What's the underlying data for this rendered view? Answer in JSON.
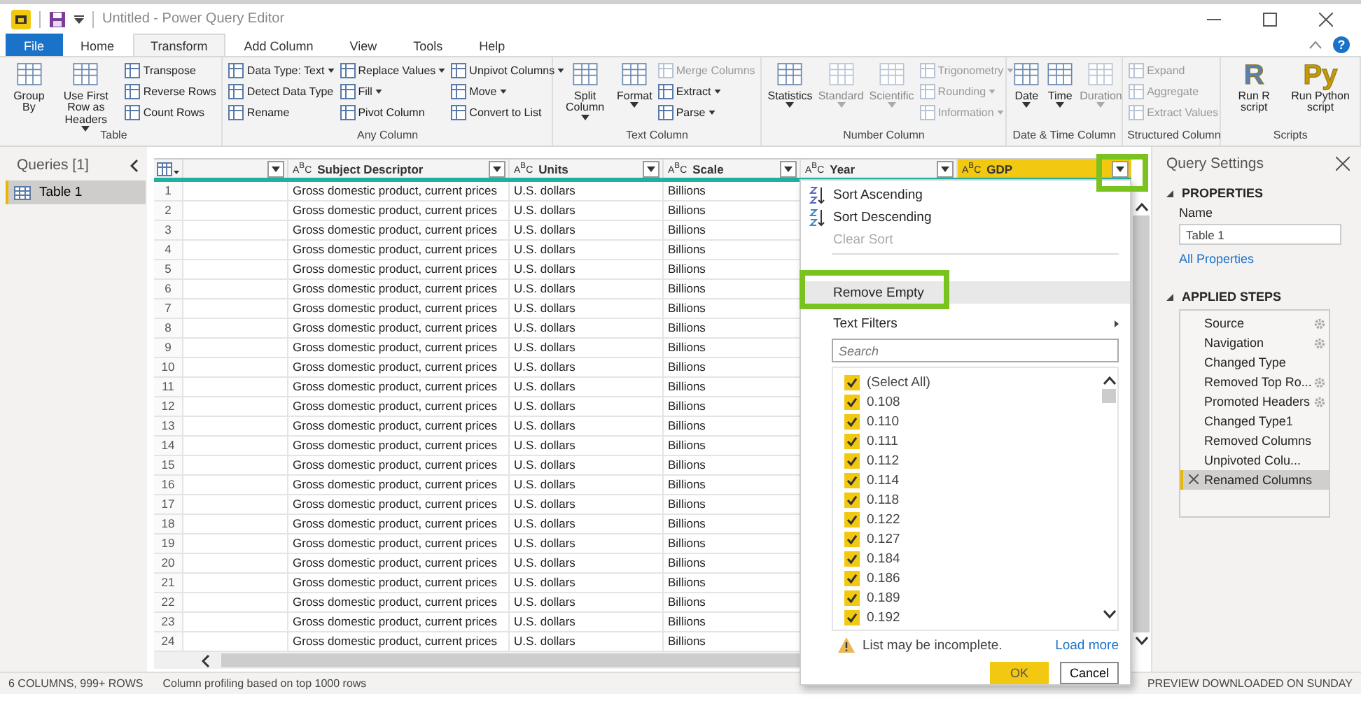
{
  "window": {
    "title": "Untitled - Power Query Editor"
  },
  "ribbon": {
    "help": "?",
    "tabs": [
      {
        "label": "File",
        "kind": "file",
        "selected": false
      },
      {
        "label": "Home",
        "kind": "tab",
        "selected": false
      },
      {
        "label": "Transform",
        "kind": "tab",
        "selected": true
      },
      {
        "label": "Add Column",
        "kind": "tab",
        "selected": false
      },
      {
        "label": "View",
        "kind": "tab",
        "selected": false
      },
      {
        "label": "Tools",
        "kind": "tab",
        "selected": false
      },
      {
        "label": "Help",
        "kind": "tab",
        "selected": false
      }
    ],
    "groups": [
      {
        "label": "Table",
        "items": [
          {
            "kind": "large",
            "label": "Group By",
            "dropdown": false,
            "disabled": false
          },
          {
            "kind": "large",
            "label": "Use First Row as Headers",
            "dropdown": true,
            "disabled": false
          },
          {
            "kind": "stack",
            "items": [
              {
                "label": "Transpose",
                "dropdown": false,
                "disabled": false
              },
              {
                "label": "Reverse Rows",
                "dropdown": false,
                "disabled": false
              },
              {
                "label": "Count Rows",
                "dropdown": false,
                "disabled": false
              }
            ]
          }
        ]
      },
      {
        "label": "Any Column",
        "items": [
          {
            "kind": "stack",
            "items": [
              {
                "label": "Data Type: Text",
                "dropdown": true,
                "disabled": false
              },
              {
                "label": "Detect Data Type",
                "dropdown": false,
                "disabled": false
              },
              {
                "label": "Rename",
                "dropdown": false,
                "disabled": false
              }
            ]
          },
          {
            "kind": "stack",
            "items": [
              {
                "label": "Replace Values",
                "dropdown": true,
                "disabled": false
              },
              {
                "label": "Fill",
                "dropdown": true,
                "disabled": false
              },
              {
                "label": "Pivot Column",
                "dropdown": false,
                "disabled": false
              }
            ]
          },
          {
            "kind": "stack",
            "items": [
              {
                "label": "Unpivot Columns",
                "dropdown": true,
                "disabled": false
              },
              {
                "label": "Move",
                "dropdown": true,
                "disabled": false
              },
              {
                "label": "Convert to List",
                "dropdown": false,
                "disabled": false
              }
            ]
          }
        ]
      },
      {
        "label": "Text Column",
        "items": [
          {
            "kind": "large",
            "label": "Split Column",
            "dropdown": true,
            "disabled": false
          },
          {
            "kind": "large",
            "label": "Format",
            "dropdown": true,
            "disabled": false
          },
          {
            "kind": "stack",
            "items": [
              {
                "label": "Merge Columns",
                "dropdown": false,
                "disabled": true
              },
              {
                "label": "Extract",
                "dropdown": true,
                "disabled": false
              },
              {
                "label": "Parse",
                "dropdown": true,
                "disabled": false
              }
            ]
          }
        ]
      },
      {
        "label": "Number Column",
        "items": [
          {
            "kind": "large",
            "label": "Statistics",
            "dropdown": true,
            "disabled": false
          },
          {
            "kind": "large",
            "label": "Standard",
            "dropdown": true,
            "disabled": true
          },
          {
            "kind": "large",
            "label": "Scientific",
            "dropdown": true,
            "disabled": true
          },
          {
            "kind": "stack",
            "items": [
              {
                "label": "Trigonometry",
                "dropdown": true,
                "disabled": true
              },
              {
                "label": "Rounding",
                "dropdown": true,
                "disabled": true
              },
              {
                "label": "Information",
                "dropdown": true,
                "disabled": true
              }
            ]
          }
        ]
      },
      {
        "label": "Date & Time Column",
        "items": [
          {
            "kind": "large",
            "label": "Date",
            "dropdown": true,
            "disabled": false
          },
          {
            "kind": "large",
            "label": "Time",
            "dropdown": true,
            "disabled": false
          },
          {
            "kind": "large",
            "label": "Duration",
            "dropdown": true,
            "disabled": true
          }
        ]
      },
      {
        "label": "Structured Column",
        "items": [
          {
            "kind": "stack",
            "items": [
              {
                "label": "Expand",
                "dropdown": false,
                "disabled": true
              },
              {
                "label": "Aggregate",
                "dropdown": false,
                "disabled": true
              },
              {
                "label": "Extract Values",
                "dropdown": false,
                "disabled": true
              }
            ]
          }
        ]
      },
      {
        "label": "Scripts",
        "items": [
          {
            "kind": "large",
            "glyph": "R",
            "color": "#5b7fae",
            "label": "Run R script",
            "dropdown": false,
            "disabled": false
          },
          {
            "kind": "large",
            "glyph": "Py",
            "color": "#c99a00",
            "label": "Run Python script",
            "dropdown": false,
            "disabled": false
          }
        ]
      }
    ]
  },
  "queries": {
    "title": "Queries [1]",
    "items": [
      {
        "label": "Table 1",
        "selected": true
      }
    ]
  },
  "table": {
    "columns": [
      {
        "kind": "any",
        "selected": false
      },
      {
        "kind": "text",
        "type": "A$^{B}$C",
        "label": "Subject Descriptor",
        "selected": false
      },
      {
        "kind": "text",
        "type": "A$^{B}$C",
        "label": "Units",
        "selected": false
      },
      {
        "kind": "text",
        "type": "A$^{B}$C",
        "label": "Scale",
        "selected": false
      },
      {
        "kind": "text",
        "type": "A$^{B}$C",
        "label": "Year",
        "selected": false
      },
      {
        "kind": "text",
        "type": "A$^{B}$C",
        "label": "GDP",
        "selected": true
      }
    ],
    "rows": [
      {
        "number": "1",
        "subject_descriptor": "Gross domestic product, current prices",
        "units": "U.S. dollars",
        "scale": "Billions"
      },
      {
        "number": "2",
        "subject_descriptor": "Gross domestic product, current prices",
        "units": "U.S. dollars",
        "scale": "Billions"
      },
      {
        "number": "3",
        "subject_descriptor": "Gross domestic product, current prices",
        "units": "U.S. dollars",
        "scale": "Billions"
      },
      {
        "number": "4",
        "subject_descriptor": "Gross domestic product, current prices",
        "units": "U.S. dollars",
        "scale": "Billions"
      },
      {
        "number": "5",
        "subject_descriptor": "Gross domestic product, current prices",
        "units": "U.S. dollars",
        "scale": "Billions"
      },
      {
        "number": "6",
        "subject_descriptor": "Gross domestic product, current prices",
        "units": "U.S. dollars",
        "scale": "Billions"
      },
      {
        "number": "7",
        "subject_descriptor": "Gross domestic product, current prices",
        "units": "U.S. dollars",
        "scale": "Billions"
      },
      {
        "number": "8",
        "subject_descriptor": "Gross domestic product, current prices",
        "units": "U.S. dollars",
        "scale": "Billions"
      },
      {
        "number": "9",
        "subject_descriptor": "Gross domestic product, current prices",
        "units": "U.S. dollars",
        "scale": "Billions"
      },
      {
        "number": "10",
        "subject_descriptor": "Gross domestic product, current prices",
        "units": "U.S. dollars",
        "scale": "Billions"
      },
      {
        "number": "11",
        "subject_descriptor": "Gross domestic product, current prices",
        "units": "U.S. dollars",
        "scale": "Billions"
      },
      {
        "number": "12",
        "subject_descriptor": "Gross domestic product, current prices",
        "units": "U.S. dollars",
        "scale": "Billions"
      },
      {
        "number": "13",
        "subject_descriptor": "Gross domestic product, current prices",
        "units": "U.S. dollars",
        "scale": "Billions"
      },
      {
        "number": "14",
        "subject_descriptor": "Gross domestic product, current prices",
        "units": "U.S. dollars",
        "scale": "Billions"
      },
      {
        "number": "15",
        "subject_descriptor": "Gross domestic product, current prices",
        "units": "U.S. dollars",
        "scale": "Billions"
      },
      {
        "number": "16",
        "subject_descriptor": "Gross domestic product, current prices",
        "units": "U.S. dollars",
        "scale": "Billions"
      },
      {
        "number": "17",
        "subject_descriptor": "Gross domestic product, current prices",
        "units": "U.S. dollars",
        "scale": "Billions"
      },
      {
        "number": "18",
        "subject_descriptor": "Gross domestic product, current prices",
        "units": "U.S. dollars",
        "scale": "Billions"
      },
      {
        "number": "19",
        "subject_descriptor": "Gross domestic product, current prices",
        "units": "U.S. dollars",
        "scale": "Billions"
      },
      {
        "number": "20",
        "subject_descriptor": "Gross domestic product, current prices",
        "units": "U.S. dollars",
        "scale": "Billions"
      },
      {
        "number": "21",
        "subject_descriptor": "Gross domestic product, current prices",
        "units": "U.S. dollars",
        "scale": "Billions"
      },
      {
        "number": "22",
        "subject_descriptor": "Gross domestic product, current prices",
        "units": "U.S. dollars",
        "scale": "Billions"
      },
      {
        "number": "23",
        "subject_descriptor": "Gross domestic product, current prices",
        "units": "U.S. dollars",
        "scale": "Billions"
      },
      {
        "number": "24",
        "subject_descriptor": "Gross domestic product, current prices",
        "units": "U.S. dollars",
        "scale": "Billions"
      }
    ]
  },
  "filter_menu": {
    "items": [
      {
        "kind": "sort-asc",
        "label": "Sort Ascending",
        "disabled": false,
        "hovered": false,
        "submenu": false
      },
      {
        "kind": "sort-desc",
        "label": "Sort Descending",
        "disabled": false,
        "hovered": false,
        "submenu": false
      },
      {
        "kind": "plain",
        "label": "Clear Sort",
        "disabled": true,
        "hovered": false,
        "submenu": false
      },
      {
        "kind": "plain",
        "label": "Remove Empty",
        "disabled": false,
        "hovered": true,
        "submenu": false
      },
      {
        "kind": "plain",
        "label": "Text Filters",
        "disabled": false,
        "hovered": false,
        "submenu": true
      }
    ],
    "search": {
      "placeholder": "Search"
    },
    "values": [
      {
        "label": "(Select All)",
        "checked": true
      },
      {
        "label": "0.108",
        "checked": true
      },
      {
        "label": "0.110",
        "checked": true
      },
      {
        "label": "0.111",
        "checked": true
      },
      {
        "label": "0.112",
        "checked": true
      },
      {
        "label": "0.114",
        "checked": true
      },
      {
        "label": "0.118",
        "checked": true
      },
      {
        "label": "0.122",
        "checked": true
      },
      {
        "label": "0.127",
        "checked": true
      },
      {
        "label": "0.184",
        "checked": true
      },
      {
        "label": "0.186",
        "checked": true
      },
      {
        "label": "0.189",
        "checked": true
      },
      {
        "label": "0.192",
        "checked": true
      }
    ],
    "warning": "List may be incomplete.",
    "load_more": "Load more",
    "buttons": [
      {
        "label": "OK",
        "kind": "primary"
      },
      {
        "label": "Cancel",
        "kind": "secondary"
      }
    ]
  },
  "query_settings": {
    "title": "Query Settings",
    "properties": {
      "heading": "PROPERTIES",
      "name_label": "Name",
      "name_value": "Table 1",
      "link": "All Properties"
    },
    "steps_heading": "APPLIED STEPS",
    "steps": [
      {
        "label": "Source",
        "gear": true,
        "selected": false
      },
      {
        "label": "Navigation",
        "gear": true,
        "selected": false
      },
      {
        "label": "Changed Type",
        "gear": false,
        "selected": false
      },
      {
        "label": "Removed Top Ro...",
        "gear": true,
        "selected": false
      },
      {
        "label": "Promoted Headers",
        "gear": true,
        "selected": false
      },
      {
        "label": "Changed Type1",
        "gear": false,
        "selected": false
      },
      {
        "label": "Removed Columns",
        "gear": false,
        "selected": false
      },
      {
        "label": "Unpivoted Colu...",
        "gear": false,
        "selected": false
      },
      {
        "label": "Renamed Columns",
        "gear": false,
        "selected": true
      }
    ]
  },
  "status_bar": {
    "left": [
      "6 COLUMNS, 999+ ROWS",
      "Column profiling based on top 1000 rows"
    ],
    "right": "PREVIEW DOWNLOADED ON SUNDAY"
  }
}
